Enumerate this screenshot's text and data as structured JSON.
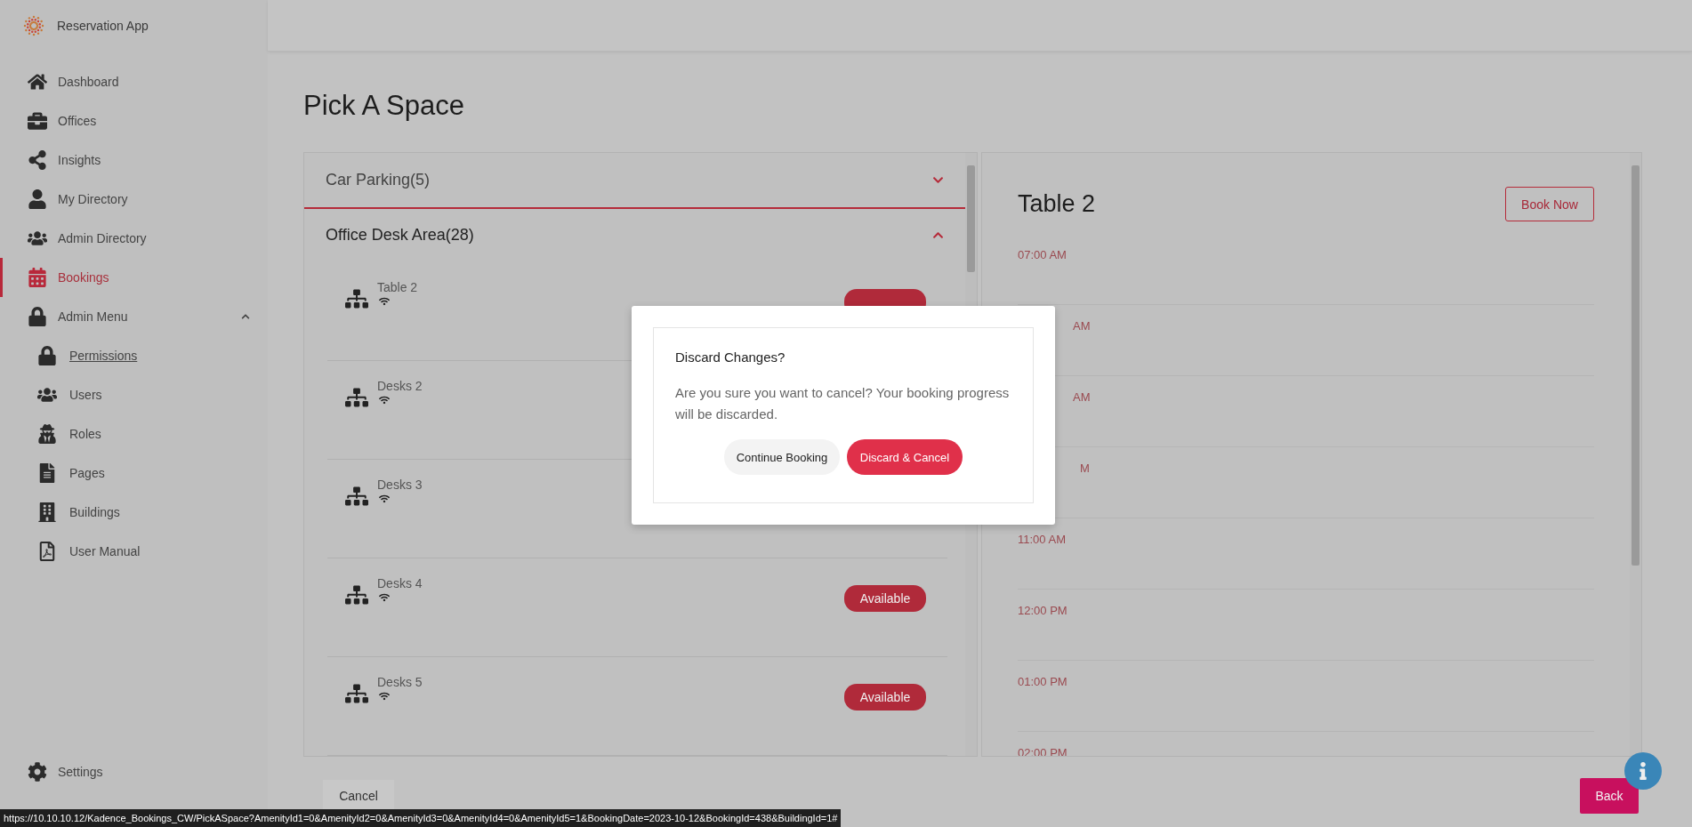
{
  "app": {
    "name": "Reservation App"
  },
  "sidebar": {
    "items": [
      {
        "label": "Dashboard",
        "selected": false
      },
      {
        "label": "Offices",
        "selected": false
      },
      {
        "label": "Insights",
        "selected": false
      },
      {
        "label": "My Directory",
        "selected": false
      },
      {
        "label": "Admin Directory",
        "selected": false
      },
      {
        "label": "Bookings",
        "selected": true
      }
    ],
    "admin_menu": {
      "label": "Admin Menu",
      "expanded": true,
      "children": [
        {
          "label": "Permissions",
          "hovered": true
        },
        {
          "label": "Users",
          "hovered": false
        },
        {
          "label": "Roles",
          "hovered": false
        },
        {
          "label": "Pages",
          "hovered": false
        },
        {
          "label": "Buildings",
          "hovered": false
        },
        {
          "label": "User Manual",
          "hovered": false
        }
      ]
    },
    "settings": {
      "label": "Settings"
    }
  },
  "page": {
    "title": "Pick A Space"
  },
  "spaces": {
    "sections": [
      {
        "title": "Car Parking(5)",
        "expanded": false
      },
      {
        "title": "Office Desk Area(28)",
        "expanded": true
      }
    ],
    "items": [
      {
        "name": "Table 2",
        "kind": "covered"
      },
      {
        "name": "Desks 2",
        "kind": "none"
      },
      {
        "name": "Desks 3",
        "kind": "none"
      },
      {
        "name": "Desks 4",
        "kind": "badge",
        "badge": "Available"
      },
      {
        "name": "Desks 5",
        "kind": "badge",
        "badge": "Available"
      }
    ]
  },
  "detail": {
    "title": "Table 2",
    "button": "Book Now",
    "slots": [
      {
        "time": "07:00 AM",
        "kind": "full"
      },
      {
        "time": "AM",
        "kind": "partial"
      },
      {
        "time": "AM",
        "kind": "partial"
      },
      {
        "time": "M",
        "kind": "partial"
      },
      {
        "time": "11:00 AM",
        "kind": "full"
      },
      {
        "time": "12:00 PM",
        "kind": "full"
      },
      {
        "time": "01:00 PM",
        "kind": "full"
      },
      {
        "time": "02:00 PM",
        "kind": "full"
      }
    ]
  },
  "footer": {
    "cancel": "Cancel",
    "back": "Back"
  },
  "dialog": {
    "title": "Discard Changes?",
    "message": "Are you sure you want to cancel? Your booking progress will be discarded.",
    "buttons": [
      {
        "label": "Continue Booking",
        "kind": "secondary"
      },
      {
        "label": "Discard & Cancel",
        "kind": "primary"
      }
    ]
  },
  "status_url": "https://10.10.10.12/Kadence_Bookings_CW/PickASpace?AmenityId1=0&AmenityId2=0&AmenityId3=0&AmenityId4=0&AmenityId5=1&BookingDate=2023-10-12&BookingId=438&BuildingId=1#"
}
